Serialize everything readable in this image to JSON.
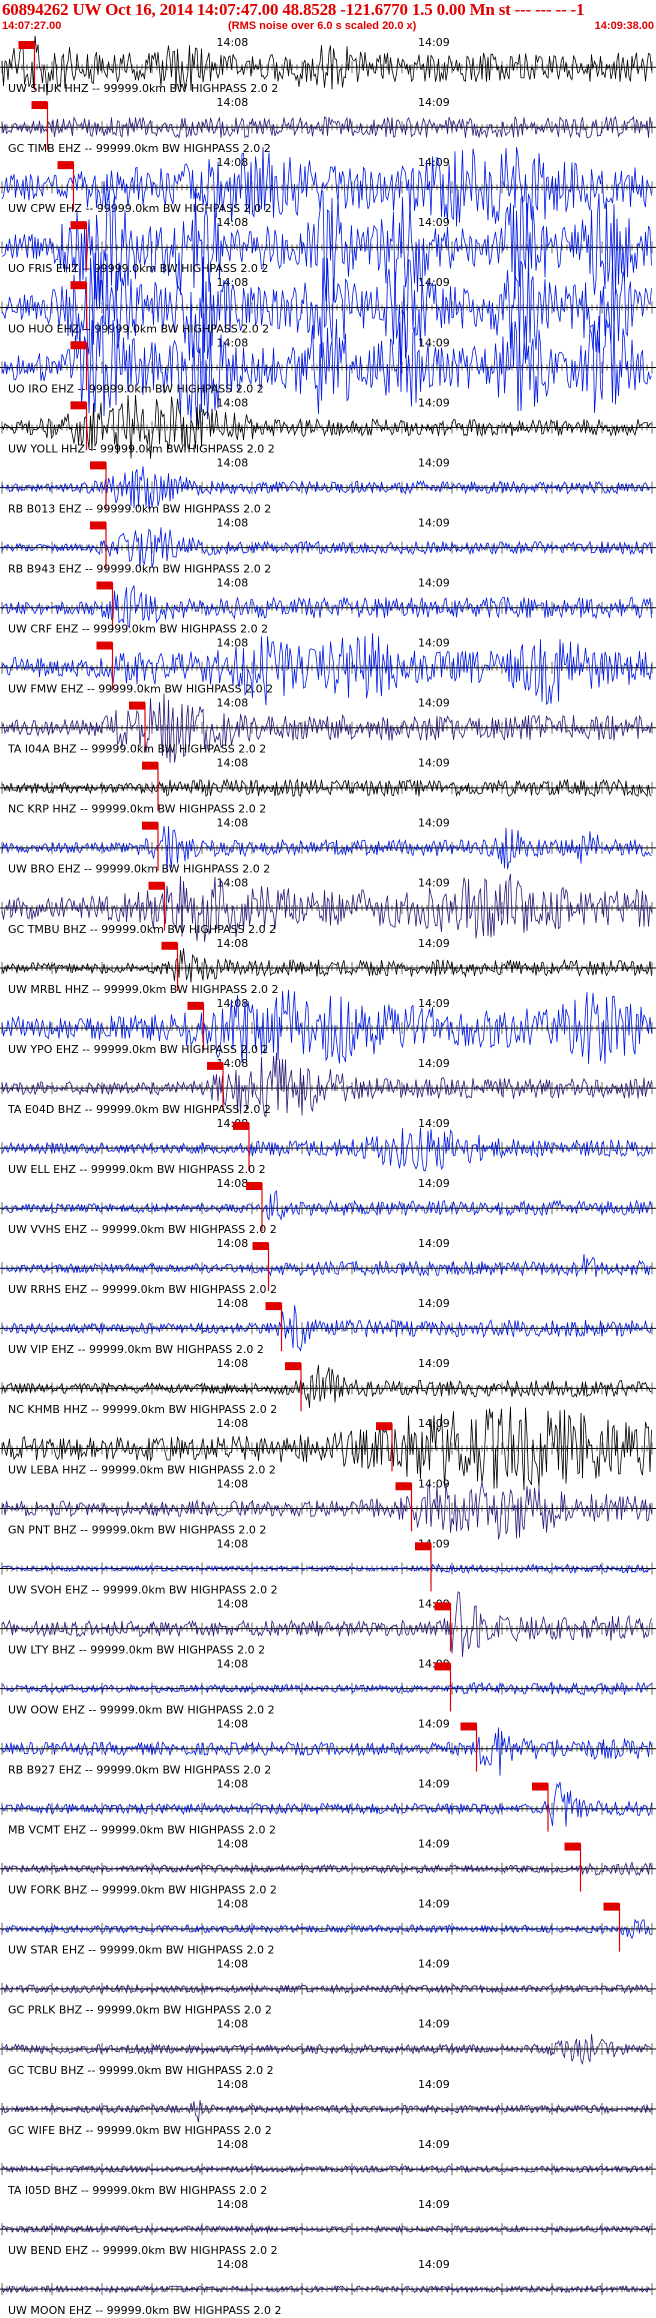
{
  "header": {
    "title": "60894262 UW Oct 16, 2014 14:07:47.00   48.8528 -121.6770  1.5 0.00 Mn st --- --- --  -1",
    "start_time": "14:07:27.00",
    "note": "(RMS noise over 6.0 s scaled 20.0 x)",
    "end_time": "14:09:38.00"
  },
  "tick_labels": [
    "14:08",
    "14:09"
  ],
  "colors": {
    "black": "#000000",
    "blue": "#0018e6",
    "purple": "#2a1a7a",
    "pick": "#e00000"
  },
  "channels": [
    {
      "label": "UW SHUK HHZ -- 99999.0km BW  HIGHPASS  2.0  2",
      "color": "black",
      "pick": 0.05,
      "amp": 0.7,
      "seed": 3,
      "bursts": [
        [
          0.05,
          0.06,
          2.0
        ],
        [
          0.28,
          0.04,
          1.2
        ],
        [
          0.5,
          0.05,
          1.1
        ]
      ]
    },
    {
      "label": "GC TIMB EHZ -- 99999.0km BW  HIGHPASS  2.0  2",
      "color": "purple",
      "pick": 0.07,
      "amp": 0.5,
      "seed": 7,
      "bursts": []
    },
    {
      "label": "UW CPW EHZ -- 99999.0km BW  HIGHPASS  2.0  2",
      "color": "blue",
      "pick": 0.11,
      "amp": 1.0,
      "seed": 11,
      "bursts": [
        [
          0.4,
          0.08,
          1.5
        ],
        [
          0.75,
          0.1,
          1.8
        ]
      ]
    },
    {
      "label": "UO FRIS EHZ -- 99999.0km BW  HIGHPASS  2.0  2",
      "color": "blue",
      "pick": 0.13,
      "amp": 1.0,
      "seed": 13,
      "bursts": [
        [
          0.15,
          0.05,
          3.0
        ],
        [
          0.3,
          0.04,
          3.0
        ],
        [
          0.5,
          0.03,
          3.0
        ],
        [
          0.62,
          0.03,
          3.0
        ],
        [
          0.8,
          0.03,
          3.0
        ],
        [
          0.93,
          0.03,
          3.0
        ]
      ]
    },
    {
      "label": "UO HUO EHZ -- 99999.0km BW  HIGHPASS  2.0  2",
      "color": "blue",
      "pick": 0.13,
      "amp": 1.0,
      "seed": 17,
      "bursts": [
        [
          0.15,
          0.05,
          3.0
        ],
        [
          0.3,
          0.04,
          3.0
        ],
        [
          0.5,
          0.03,
          3.0
        ],
        [
          0.62,
          0.03,
          3.0
        ],
        [
          0.8,
          0.03,
          3.0
        ],
        [
          0.93,
          0.03,
          3.0
        ]
      ]
    },
    {
      "label": "UO IRO EHZ -- 99999.0km BW  HIGHPASS  2.0  2",
      "color": "blue",
      "pick": 0.13,
      "amp": 1.0,
      "seed": 19,
      "bursts": [
        [
          0.15,
          0.05,
          3.0
        ],
        [
          0.3,
          0.04,
          3.0
        ],
        [
          0.5,
          0.03,
          3.0
        ],
        [
          0.62,
          0.03,
          3.0
        ],
        [
          0.8,
          0.03,
          3.0
        ],
        [
          0.93,
          0.03,
          3.0
        ]
      ]
    },
    {
      "label": "UW YOLL HHZ -- 99999.0km BW  HIGHPASS  2.0  2",
      "color": "black",
      "pick": 0.13,
      "amp": 0.4,
      "seed": 23,
      "bursts": [
        [
          0.22,
          0.12,
          5.0
        ]
      ]
    },
    {
      "label": "RB B013 EHZ -- 99999.0km BW  HIGHPASS  2.0  2",
      "color": "blue",
      "pick": 0.16,
      "amp": 0.3,
      "seed": 29,
      "bursts": [
        [
          0.22,
          0.06,
          4.0
        ]
      ]
    },
    {
      "label": "RB B943 EHZ -- 99999.0km BW  HIGHPASS  2.0  2",
      "color": "blue",
      "pick": 0.16,
      "amp": 0.3,
      "seed": 31,
      "bursts": [
        [
          0.23,
          0.06,
          4.0
        ]
      ]
    },
    {
      "label": "UW CRF EHZ -- 99999.0km BW  HIGHPASS  2.0  2",
      "color": "blue",
      "pick": 0.17,
      "amp": 0.5,
      "seed": 37,
      "bursts": [
        [
          0.2,
          0.04,
          2.0
        ]
      ]
    },
    {
      "label": "UW FMW EHZ -- 99999.0km BW  HIGHPASS  2.0  2",
      "color": "blue",
      "pick": 0.17,
      "amp": 0.8,
      "seed": 41,
      "bursts": [
        [
          0.4,
          0.05,
          2.0
        ],
        [
          0.55,
          0.05,
          2.0
        ],
        [
          0.85,
          0.05,
          2.0
        ]
      ]
    },
    {
      "label": "TA I04A BHZ -- 99999.0km BW  HIGHPASS  2.0  2",
      "color": "purple",
      "pick": 0.22,
      "amp": 0.6,
      "seed": 43,
      "bursts": [
        [
          0.25,
          0.08,
          3.0
        ]
      ]
    },
    {
      "label": "NC KRP HHZ -- 99999.0km BW  HIGHPASS  2.0  2",
      "color": "black",
      "pick": 0.24,
      "amp": 0.4,
      "seed": 47,
      "bursts": []
    },
    {
      "label": "UW BRO EHZ -- 99999.0km BW  HIGHPASS  2.0  2",
      "color": "blue",
      "pick": 0.24,
      "amp": 0.4,
      "seed": 53,
      "bursts": [
        [
          0.25,
          0.03,
          3.0
        ],
        [
          0.78,
          0.02,
          3.0
        ],
        [
          0.9,
          0.02,
          3.0
        ]
      ]
    },
    {
      "label": "GC TMBU BHZ -- 99999.0km BW  HIGHPASS  2.0  2",
      "color": "purple",
      "pick": 0.25,
      "amp": 0.9,
      "seed": 59,
      "bursts": [
        [
          0.3,
          0.08,
          1.6
        ],
        [
          0.75,
          0.07,
          1.6
        ]
      ]
    },
    {
      "label": "UW MRBL HHZ -- 99999.0km BW  HIGHPASS  2.0  2",
      "color": "black",
      "pick": 0.27,
      "amp": 0.4,
      "seed": 61,
      "bursts": [
        [
          0.29,
          0.03,
          3.0
        ]
      ]
    },
    {
      "label": "UW YPO EHZ -- 99999.0km BW  HIGHPASS  2.0  2",
      "color": "blue",
      "pick": 0.31,
      "amp": 0.9,
      "seed": 67,
      "bursts": [
        [
          0.45,
          0.15,
          1.8
        ],
        [
          0.92,
          0.06,
          1.6
        ]
      ]
    },
    {
      "label": "TA E04D BHZ -- 99999.0km BW  HIGHPASS  2.0  2",
      "color": "purple",
      "pick": 0.34,
      "amp": 0.5,
      "seed": 71,
      "bursts": [
        [
          0.42,
          0.08,
          4.0
        ]
      ]
    },
    {
      "label": "UW ELL EHZ -- 99999.0km BW  HIGHPASS  2.0  2",
      "color": "blue",
      "pick": 0.38,
      "amp": 0.4,
      "seed": 73,
      "bursts": [
        [
          0.65,
          0.08,
          3.0
        ]
      ]
    },
    {
      "label": "UW VVHS EHZ -- 99999.0km BW  HIGHPASS  2.0  2",
      "color": "blue",
      "pick": 0.4,
      "amp": 0.35,
      "seed": 79,
      "bursts": [
        [
          0.42,
          0.01,
          3.0
        ]
      ]
    },
    {
      "label": "UW RRHS EHZ -- 99999.0km BW  HIGHPASS  2.0  2",
      "color": "blue",
      "pick": 0.41,
      "amp": 0.35,
      "seed": 83,
      "bursts": [
        [
          0.9,
          0.01,
          2.5
        ]
      ]
    },
    {
      "label": "UW VIP EHZ -- 99999.0km BW  HIGHPASS  2.0  2",
      "color": "blue",
      "pick": 0.43,
      "amp": 0.4,
      "seed": 89,
      "bursts": [
        [
          0.45,
          0.02,
          4.0
        ]
      ]
    },
    {
      "label": "NC KHMB HHZ -- 99999.0km BW  HIGHPASS  2.0  2",
      "color": "black",
      "pick": 0.46,
      "amp": 0.4,
      "seed": 97,
      "bursts": [
        [
          0.49,
          0.03,
          3.0
        ]
      ]
    },
    {
      "label": "UW LEBA HHZ -- 99999.0km BW  HIGHPASS  2.0  2",
      "color": "black",
      "pick": 0.6,
      "amp": 0.9,
      "seed": 101,
      "bursts": [
        [
          0.78,
          0.22,
          2.0
        ]
      ]
    },
    {
      "label": "GN PNT BHZ -- 99999.0km BW  HIGHPASS  2.0  2",
      "color": "purple",
      "pick": 0.63,
      "amp": 0.6,
      "seed": 103,
      "bursts": [
        [
          0.75,
          0.12,
          2.5
        ]
      ]
    },
    {
      "label": "UW SVOH EHZ -- 99999.0km BW  HIGHPASS  2.0  2",
      "color": "blue",
      "pick": 0.66,
      "amp": 0.2,
      "seed": 107,
      "bursts": []
    },
    {
      "label": "UW LTY BHZ -- 99999.0km BW  HIGHPASS  2.0  2",
      "color": "purple",
      "pick": 0.69,
      "amp": 0.6,
      "seed": 109,
      "bursts": [
        [
          0.71,
          0.02,
          4.0
        ]
      ]
    },
    {
      "label": "UW OOW EHZ -- 99999.0km BW  HIGHPASS  2.0  2",
      "color": "blue",
      "pick": 0.69,
      "amp": 0.3,
      "seed": 113,
      "bursts": []
    },
    {
      "label": "RB B927 EHZ -- 99999.0km BW  HIGHPASS  2.0  2",
      "color": "blue",
      "pick": 0.73,
      "amp": 0.5,
      "seed": 127,
      "bursts": [
        [
          0.76,
          0.02,
          3.0
        ]
      ]
    },
    {
      "label": "MB VCMT EHZ -- 99999.0km BW  HIGHPASS  2.0  2",
      "color": "blue",
      "pick": 0.84,
      "amp": 0.4,
      "seed": 131,
      "bursts": [
        [
          0.86,
          0.02,
          3.5
        ]
      ]
    },
    {
      "label": "UW FORK BHZ -- 99999.0km BW  HIGHPASS  2.0  2",
      "color": "purple",
      "pick": 0.89,
      "amp": 0.3,
      "seed": 137,
      "bursts": []
    },
    {
      "label": "UW STAR EHZ -- 99999.0km BW  HIGHPASS  2.0  2",
      "color": "blue",
      "pick": 0.95,
      "amp": 0.3,
      "seed": 139,
      "bursts": [
        [
          0.975,
          0.01,
          5.0
        ]
      ]
    },
    {
      "label": "GC PRLK BHZ -- 99999.0km BW  HIGHPASS  2.0  2",
      "color": "purple",
      "pick": null,
      "amp": 0.3,
      "seed": 149,
      "bursts": []
    },
    {
      "label": "GC TCBU BHZ -- 99999.0km BW  HIGHPASS  2.0  2",
      "color": "purple",
      "pick": null,
      "amp": 0.35,
      "seed": 151,
      "bursts": [
        [
          0.9,
          0.04,
          2.5
        ]
      ]
    },
    {
      "label": "GC WIFE BHZ -- 99999.0km BW  HIGHPASS  2.0  2",
      "color": "purple",
      "pick": null,
      "amp": 0.3,
      "seed": 157,
      "bursts": [
        [
          0.3,
          0.01,
          2.5
        ]
      ]
    },
    {
      "label": "TA I05D BHZ -- 99999.0km BW  HIGHPASS  2.0  2",
      "color": "purple",
      "pick": null,
      "amp": 0.25,
      "seed": 163,
      "bursts": []
    },
    {
      "label": "UW BEND EHZ -- 99999.0km BW  HIGHPASS  2.0  2",
      "color": "purple",
      "pick": null,
      "amp": 0.25,
      "seed": 167,
      "bursts": []
    },
    {
      "label": "UW MOON EHZ -- 99999.0km BW  HIGHPASS  2.0  2",
      "color": "purple",
      "pick": null,
      "amp": 0.25,
      "seed": 173,
      "bursts": []
    }
  ]
}
